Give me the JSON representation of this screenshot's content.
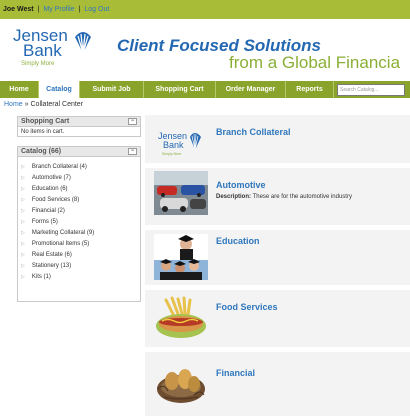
{
  "user_bar": {
    "user_name": "Joe West",
    "separator": "|",
    "profile_link": "My Profile",
    "logout_link": "Log Out"
  },
  "brand": {
    "logo_line1": "Jensen",
    "logo_line2": "Bank",
    "logo_tagline": "Simply More",
    "headline": "Client Focused Solutions",
    "subheadline": "from a Global Financia"
  },
  "nav": {
    "tabs": [
      "Home",
      "Catalog",
      "Submit Job",
      "Shopping Cart",
      "Order Manager",
      "Reports"
    ],
    "active_tab": "Catalog",
    "search_placeholder": "Search Catalog..."
  },
  "breadcrumb": {
    "home": "Home",
    "separator": "»",
    "current": "Collateral Center"
  },
  "sidebar": {
    "cart": {
      "title": "Shopping Cart",
      "toggle": "−",
      "empty_text": "No items in cart."
    },
    "catalog": {
      "title": "Catalog (66)",
      "toggle": "−",
      "items": [
        "Branch Collateral (4)",
        "Automotive (7)",
        "Education (6)",
        "Food Services (8)",
        "Financial (2)",
        "Forms (5)",
        "Marketing Collateral (9)",
        "Promotional Items (5)",
        "Real Estate (6)",
        "Stationery (13)",
        "Kits (1)"
      ]
    }
  },
  "categories": [
    {
      "title": "Branch Collateral",
      "desc_label": "",
      "desc_text": "",
      "thumb_icon": "jensen-bank-logo-thumb"
    },
    {
      "title": "Automotive",
      "desc_label": "Description:",
      "desc_text": "These are for the automotive industry",
      "thumb_icon": "cars-photo-thumb"
    },
    {
      "title": "Education",
      "desc_label": "",
      "desc_text": "",
      "thumb_icon": "graduates-photo-thumb"
    },
    {
      "title": "Food Services",
      "desc_label": "",
      "desc_text": "",
      "thumb_icon": "hotdog-photo-thumb"
    },
    {
      "title": "Financial",
      "desc_label": "",
      "desc_text": "",
      "thumb_icon": "nest-eggs-photo-thumb"
    }
  ],
  "colors": {
    "top_bar": "#a9bc38",
    "nav_bar": "#8aa32b",
    "brand_blue": "#2468b2",
    "brand_green": "#8aaf37",
    "link_blue": "#2f77bd"
  }
}
